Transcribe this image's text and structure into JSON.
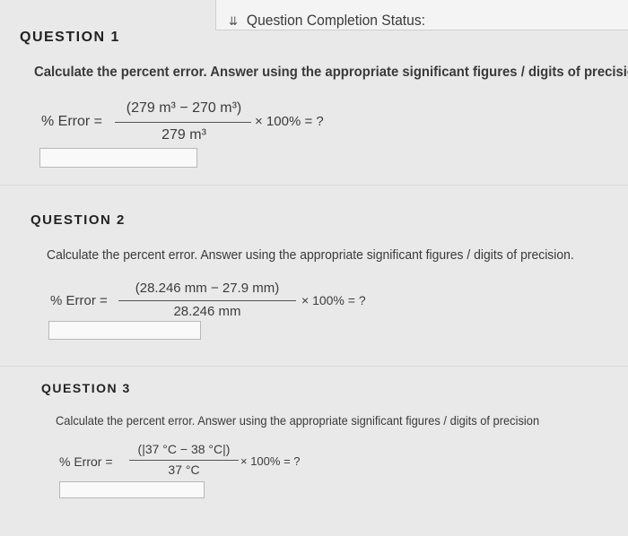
{
  "status": {
    "chevron_icon": "chevron-down-double-icon",
    "label": "Question Completion Status:"
  },
  "questions": [
    {
      "title": "QUESTION 1",
      "prompt": "Calculate the percent error. Answer using the appropriate significant figures / digits of precision",
      "formula": {
        "label": "% Error =",
        "numerator": "(279 m³ − 270 m³)",
        "denominator": "279 m³",
        "tail": "× 100% = ?"
      },
      "answer_value": ""
    },
    {
      "title": "QUESTION 2",
      "prompt": "Calculate the percent error. Answer using the appropriate significant figures / digits of precision.",
      "formula": {
        "label": "% Error =",
        "numerator": "(28.246 mm − 27.9 mm)",
        "denominator": "28.246 mm",
        "tail": "× 100% = ?"
      },
      "answer_value": ""
    },
    {
      "title": "QUESTION 3",
      "prompt": "Calculate the percent error. Answer using the appropriate significant figures / digits of precision",
      "formula": {
        "label": "% Error =",
        "numerator": "(|37 °C − 38 °C|)",
        "denominator": "37 °C",
        "tail": "× 100% = ?"
      },
      "answer_value": ""
    }
  ]
}
